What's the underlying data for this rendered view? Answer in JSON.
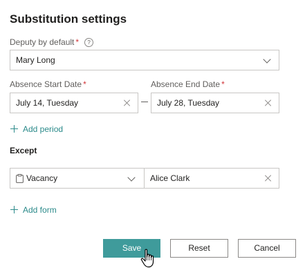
{
  "page": {
    "title": "Substitution settings"
  },
  "deputy": {
    "label": "Deputy by default",
    "required_mark": "*",
    "help": "?",
    "value": "Mary Long"
  },
  "absence_start": {
    "label": "Absence Start Date",
    "required_mark": "*",
    "value": "July 14, Tuesday"
  },
  "absence_end": {
    "label": "Absence End Date",
    "required_mark": "*",
    "value": "July 28, Tuesday"
  },
  "add_period": {
    "label": "Add period"
  },
  "except": {
    "heading": "Except",
    "form_value": "Vacancy",
    "person_value": "Alice Clark"
  },
  "add_form": {
    "label": "Add form"
  },
  "buttons": {
    "save": "Save",
    "reset": "Reset",
    "cancel": "Cancel"
  },
  "colors": {
    "accent": "#3f9b9b",
    "link": "#2b8a8a",
    "required": "#d13438"
  }
}
